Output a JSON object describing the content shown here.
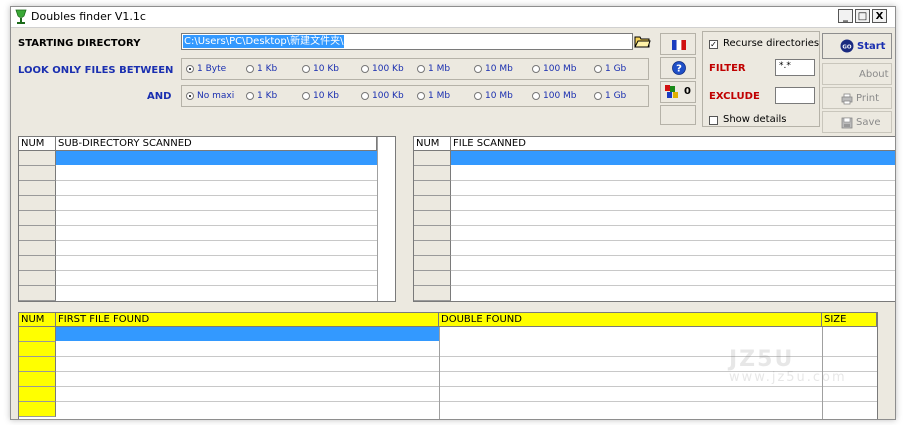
{
  "window": {
    "title": "Doubles finder  V1.1c",
    "controls": {
      "minimize": "_",
      "maximize": "□",
      "close": "X"
    }
  },
  "form": {
    "starting_directory_label": "STARTING DIRECTORY",
    "starting_directory_value": "C:\\Users\\PC\\Desktop\\新建文件夹\\",
    "look_only_label": "LOOK ONLY FILES BETWEEN",
    "and_label": "AND",
    "min_options": [
      "1 Byte",
      "1 Kb",
      "10 Kb",
      "100 Kb",
      "1 Mb",
      "10 Mb",
      "100 Mb",
      "1 Gb"
    ],
    "min_selected": "1 Byte",
    "max_options": [
      "No maxi",
      "1 Kb",
      "10 Kb",
      "100 Kb",
      "1 Mb",
      "10 Mb",
      "100 Mb",
      "1 Gb"
    ],
    "max_selected": "No maxi"
  },
  "toolbar": {
    "counter": "0"
  },
  "options": {
    "recurse_label": "Recurse directories",
    "recurse_checked": "✓",
    "filter_label": "FILTER",
    "filter_value": "*.*",
    "exclude_label": "EXCLUDE",
    "exclude_value": "",
    "show_details_label": "Show details"
  },
  "actions": {
    "start": "Start",
    "about": "About",
    "print": "Print",
    "save": "Save",
    "go_badge": "GO"
  },
  "tables": {
    "subdirs": {
      "headers": [
        "NUM",
        "SUB-DIRECTORY SCANNED"
      ]
    },
    "files": {
      "headers": [
        "NUM",
        "FILE SCANNED"
      ]
    },
    "results": {
      "headers": [
        "NUM",
        "FIRST FILE FOUND",
        "DOUBLE FOUND",
        "SIZE"
      ]
    }
  },
  "watermark": {
    "line1": "JZ5U",
    "line2": "www.jz5u.com"
  },
  "colors": {
    "selection": "#3399ff",
    "result_header": "#ffff00",
    "label_blue": "#1a2fb0",
    "label_red": "#c00000"
  }
}
